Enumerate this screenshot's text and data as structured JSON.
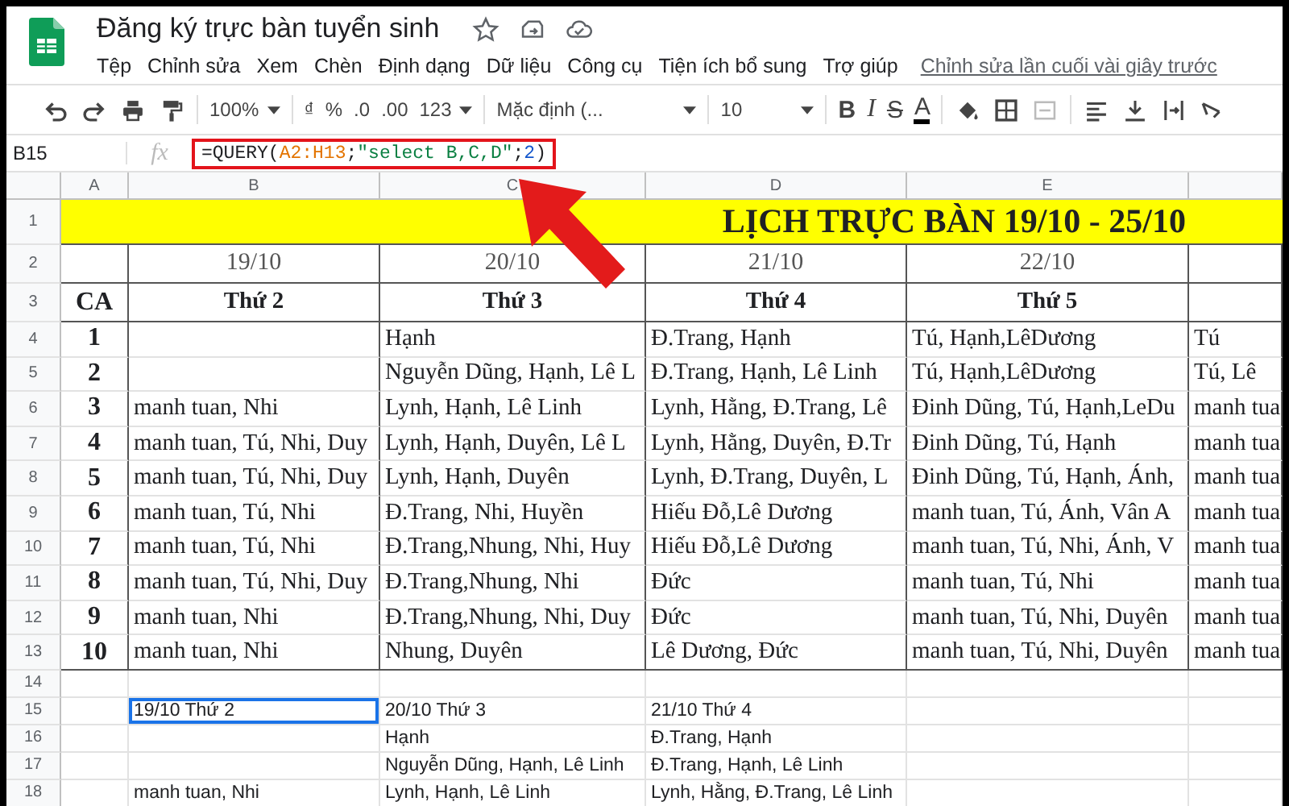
{
  "document": {
    "title": "Đăng ký trực bàn tuyển sinh",
    "last_edit": "Chỉnh sửa lần cuối vài giây trước"
  },
  "menu": [
    "Tệp",
    "Chỉnh sửa",
    "Xem",
    "Chèn",
    "Định dạng",
    "Dữ liệu",
    "Công cụ",
    "Tiện ích bổ sung",
    "Trợ giúp"
  ],
  "toolbar": {
    "zoom": "100%",
    "currency": "₫",
    "percent": "%",
    "decrease_decimal": ".0",
    "increase_decimal": ".00",
    "number_format": "123",
    "font": "Mặc định (...",
    "font_size": "10",
    "bold": "B",
    "italic": "I",
    "strikethrough": "S",
    "text_color": "A"
  },
  "formula_bar": {
    "cell_ref": "B15",
    "fx": "fx",
    "highlighted": true,
    "formula": [
      {
        "text": "=QUERY(",
        "kind": "plain"
      },
      {
        "text": "A2:H13",
        "kind": "range"
      },
      {
        "text": ";",
        "kind": "plain"
      },
      {
        "text": "\"select B,C,D\"",
        "kind": "string"
      },
      {
        "text": ";",
        "kind": "plain"
      },
      {
        "text": "2",
        "kind": "number"
      },
      {
        "text": ")",
        "kind": "plain"
      }
    ]
  },
  "columns": [
    "A",
    "B",
    "C",
    "D",
    "E"
  ],
  "row_numbers": [
    "1",
    "2",
    "3",
    "4",
    "5",
    "6",
    "7",
    "8",
    "9",
    "10",
    "11",
    "12",
    "13",
    "14",
    "15",
    "16",
    "17",
    "18"
  ],
  "sheet": {
    "title": "LỊCH TRỰC BÀN 19/10 - 25/10",
    "dates": [
      "19/10",
      "20/10",
      "21/10",
      "22/10"
    ],
    "ca_label": "CA",
    "days": [
      "Thứ 2",
      "Thứ 3",
      "Thứ 4",
      "Thứ 5"
    ],
    "shifts": [
      {
        "ca": "1",
        "cells": [
          null,
          "Hạnh",
          "Đ.Trang, Hạnh",
          "Tú, Hạnh,LêDương",
          "Tú"
        ]
      },
      {
        "ca": "2",
        "cells": [
          null,
          "Nguyễn Dũng, Hạnh, Lê L",
          "Đ.Trang, Hạnh, Lê Linh",
          "Tú, Hạnh,LêDương",
          "Tú, Lê"
        ]
      },
      {
        "ca": "3",
        "cells": [
          "manh tuan, Nhi",
          "Lynh, Hạnh, Lê Linh",
          "Lynh, Hằng, Đ.Trang, Lê",
          "Đinh Dũng, Tú, Hạnh,LeDu",
          "manh tua"
        ]
      },
      {
        "ca": "4",
        "cells": [
          "manh tuan, Tú, Nhi, Duy",
          "Lynh, Hạnh, Duyên, Lê L",
          "Lynh, Hằng, Duyên, Đ.Tr",
          "Đinh Dũng, Tú, Hạnh",
          "manh tua"
        ]
      },
      {
        "ca": "5",
        "cells": [
          "manh tuan, Tú, Nhi, Duy",
          "Lynh, Hạnh, Duyên",
          "Lynh, Đ.Trang, Duyên, L",
          "Đinh Dũng, Tú, Hạnh, Ánh,",
          "manh tua"
        ]
      },
      {
        "ca": "6",
        "cells": [
          "manh tuan, Tú, Nhi",
          "Đ.Trang, Nhi, Huyền",
          "Hiếu Đỗ,Lê Dương",
          "manh tuan, Tú, Ánh, Vân A",
          "manh tua"
        ]
      },
      {
        "ca": "7",
        "cells": [
          "manh tuan, Tú, Nhi",
          "Đ.Trang,Nhung, Nhi, Huy",
          "Hiếu Đỗ,Lê Dương",
          "manh tuan, Tú, Nhi, Ánh, V",
          "manh tua"
        ]
      },
      {
        "ca": "8",
        "cells": [
          "manh tuan, Tú, Nhi, Duy",
          "Đ.Trang,Nhung, Nhi",
          "Đức",
          "manh tuan, Tú, Nhi",
          "manh tua"
        ]
      },
      {
        "ca": "9",
        "cells": [
          "manh tuan, Nhi",
          "Đ.Trang,Nhung, Nhi, Duy",
          "Đức",
          "manh tuan, Tú, Nhi, Duyên",
          "manh tua"
        ]
      },
      {
        "ca": "10",
        "cells": [
          "manh tuan, Nhi",
          "Nhung, Duyên",
          "Lê Dương, Đức",
          "manh tuan, Tú, Nhi, Duyên",
          "manh tua"
        ]
      }
    ]
  },
  "query_rows": [
    {
      "cells": [
        {
          "text": "19/10 Thứ 2",
          "selected": true
        },
        {
          "text": "20/10 Thứ 3",
          "selected": false
        },
        {
          "text": "21/10 Thứ 4",
          "selected": false
        }
      ]
    },
    {
      "cells": [
        {
          "text": null,
          "selected": false
        },
        {
          "text": "Hạnh",
          "selected": false
        },
        {
          "text": "Đ.Trang, Hạnh",
          "selected": false
        }
      ]
    },
    {
      "cells": [
        {
          "text": null,
          "selected": false
        },
        {
          "text": "Nguyễn Dũng, Hạnh, Lê Linh",
          "selected": false
        },
        {
          "text": "Đ.Trang, Hạnh, Lê Linh",
          "selected": false
        }
      ]
    },
    {
      "cells": [
        {
          "text": "manh tuan, Nhi",
          "selected": false
        },
        {
          "text": "Lynh, Hạnh, Lê Linh",
          "selected": false
        },
        {
          "text": "Lynh, Hằng, Đ.Trang, Lê Linh",
          "selected": false
        }
      ]
    }
  ]
}
